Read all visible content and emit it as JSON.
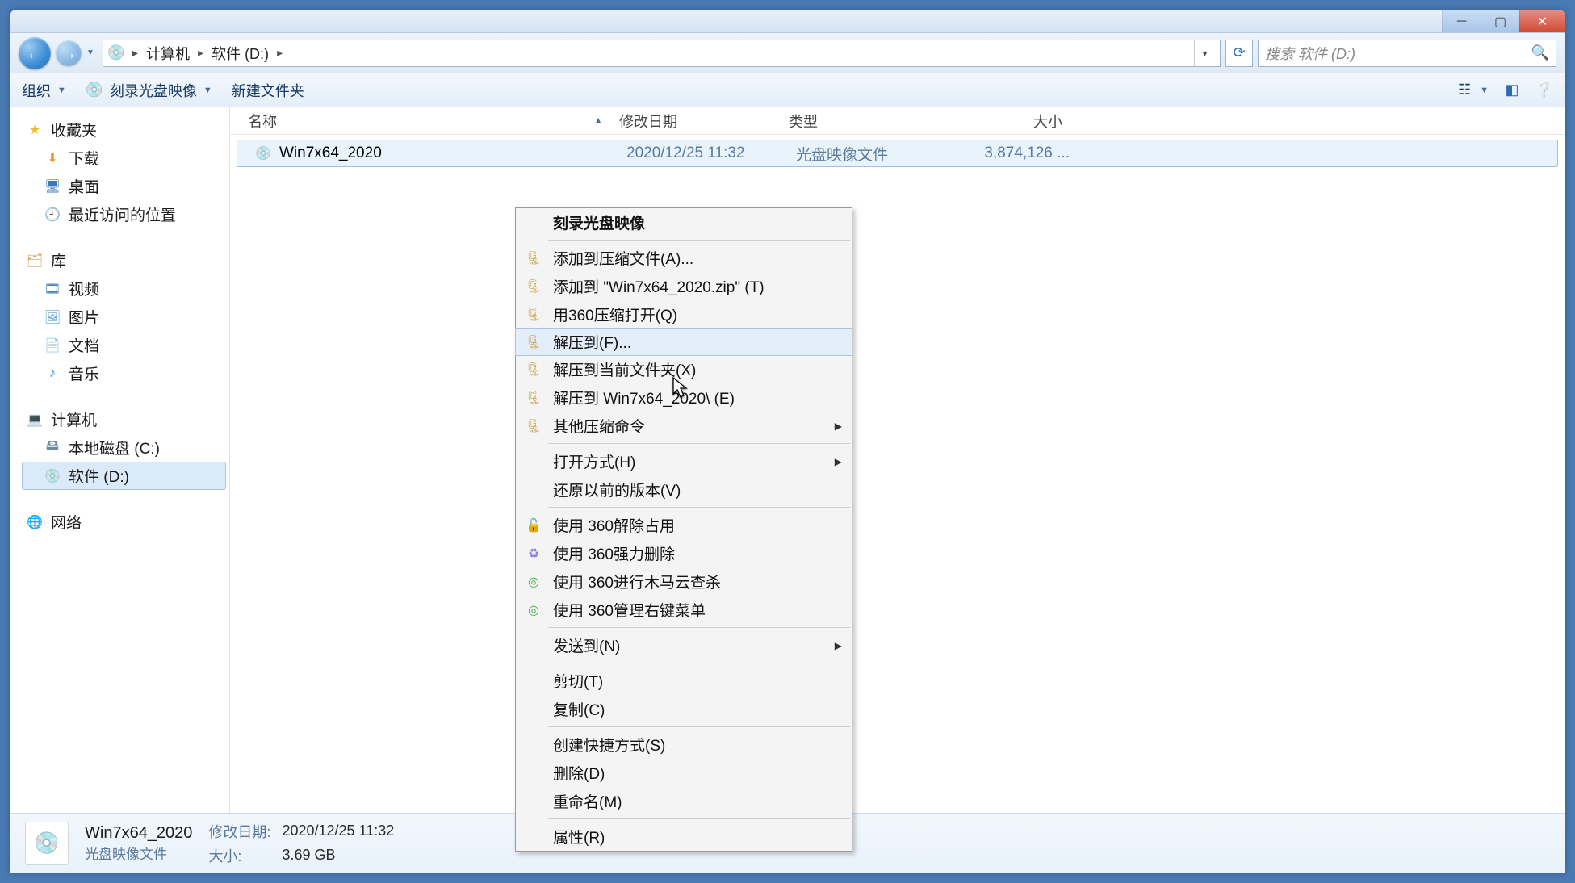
{
  "window": {
    "breadcrumb": {
      "root": "计算机",
      "current": "软件 (D:)"
    },
    "search_placeholder": "搜索 软件 (D:)"
  },
  "toolbar": {
    "organize": "组织",
    "burn": "刻录光盘映像",
    "newfolder": "新建文件夹"
  },
  "sidebar": {
    "fav_head": "收藏夹",
    "fav": [
      "下载",
      "桌面",
      "最近访问的位置"
    ],
    "lib_head": "库",
    "lib": [
      "视频",
      "图片",
      "文档",
      "音乐"
    ],
    "comp_head": "计算机",
    "comp": [
      "本地磁盘 (C:)",
      "软件 (D:)"
    ],
    "net_head": "网络"
  },
  "columns": {
    "name": "名称",
    "date": "修改日期",
    "type": "类型",
    "size": "大小"
  },
  "file": {
    "name": "Win7x64_2020",
    "date": "2020/12/25 11:32",
    "type": "光盘映像文件",
    "size": "3,874,126 ..."
  },
  "context_menu": {
    "burn": "刻录光盘映像",
    "add_archive": "添加到压缩文件(A)...",
    "add_zip": "添加到 \"Win7x64_2020.zip\" (T)",
    "open_360zip": "用360压缩打开(Q)",
    "extract_to": "解压到(F)...",
    "extract_here": "解压到当前文件夹(X)",
    "extract_named": "解压到 Win7x64_2020\\ (E)",
    "other_zip": "其他压缩命令",
    "open_with": "打开方式(H)",
    "restore_prev": "还原以前的版本(V)",
    "unlock_360": "使用 360解除占用",
    "force_del_360": "使用 360强力删除",
    "scan_360": "使用 360进行木马云查杀",
    "manage_ctx_360": "使用 360管理右键菜单",
    "send_to": "发送到(N)",
    "cut": "剪切(T)",
    "copy": "复制(C)",
    "shortcut": "创建快捷方式(S)",
    "delete": "删除(D)",
    "rename": "重命名(M)",
    "properties": "属性(R)"
  },
  "details": {
    "name": "Win7x64_2020",
    "subtype": "光盘映像文件",
    "date_label": "修改日期:",
    "date": "2020/12/25 11:32",
    "size_label": "大小:",
    "size": "3.69 GB"
  }
}
